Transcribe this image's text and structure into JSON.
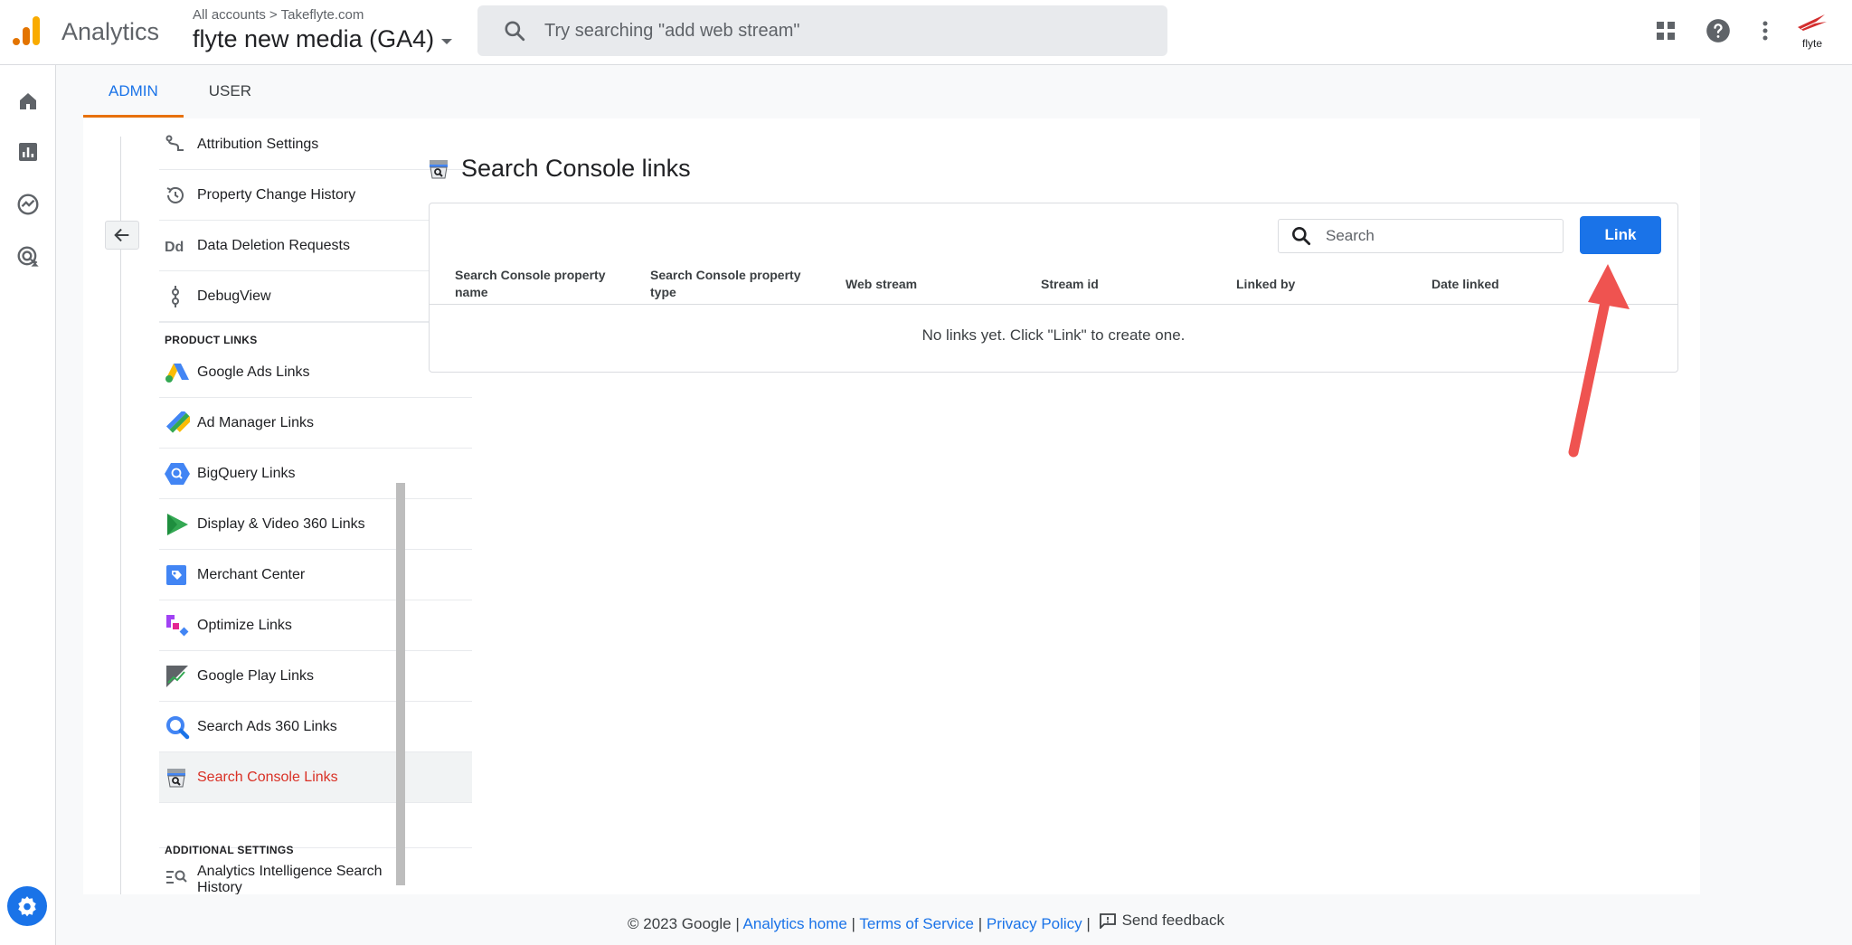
{
  "header": {
    "app_name": "Analytics",
    "breadcrumb_root": "All accounts",
    "breadcrumb_sep": ">",
    "breadcrumb_account": "Takeflyte.com",
    "property_name": "flyte new media (GA4)",
    "search_placeholder": "Try searching \"add web stream\"",
    "brand_text": "flyte"
  },
  "tabs": [
    {
      "label": "ADMIN",
      "active": true
    },
    {
      "label": "USER",
      "active": false
    }
  ],
  "sidebar": {
    "items_top": [
      {
        "label": "Attribution Settings",
        "icon": "attribution-icon"
      },
      {
        "label": "Property Change History",
        "icon": "history-icon"
      },
      {
        "label": "Data Deletion Requests",
        "icon": "data-deletion-icon"
      },
      {
        "label": "DebugView",
        "icon": "debug-icon"
      }
    ],
    "product_links_heading": "PRODUCT LINKS",
    "product_links": [
      {
        "label": "Google Ads Links",
        "icon": "google-ads-icon"
      },
      {
        "label": "Ad Manager Links",
        "icon": "ad-manager-icon"
      },
      {
        "label": "BigQuery Links",
        "icon": "bigquery-icon"
      },
      {
        "label": "Display & Video 360 Links",
        "icon": "display-video-icon"
      },
      {
        "label": "Merchant Center",
        "icon": "merchant-center-icon"
      },
      {
        "label": "Optimize Links",
        "icon": "optimize-icon"
      },
      {
        "label": "Google Play Links",
        "icon": "google-play-icon"
      },
      {
        "label": "Search Ads 360 Links",
        "icon": "search-ads-icon"
      },
      {
        "label": "Search Console Links",
        "icon": "search-console-icon",
        "active": true
      }
    ],
    "additional_heading": "ADDITIONAL SETTINGS",
    "additional_items": [
      {
        "label": "Analytics Intelligence Search History",
        "icon": "intelligence-search-icon"
      }
    ]
  },
  "main": {
    "title": "Search Console links",
    "search_placeholder": "Search",
    "link_button": "Link",
    "columns": [
      "Search Console property name",
      "Search Console property type",
      "Web stream",
      "Stream id",
      "Linked by",
      "Date linked"
    ],
    "empty_message": "No links yet. Click \"Link\" to create one."
  },
  "footer": {
    "copyright": "© 2023 Google |",
    "analytics_home": "Analytics home",
    "sep1": "|",
    "terms": "Terms of Service",
    "sep2": "|",
    "privacy": "Privacy Policy",
    "sep3": "|",
    "feedback": "Send feedback"
  },
  "colors": {
    "accent": "#1a73e8",
    "active_tab_underline": "#e8710a",
    "active_nav": "#d93025",
    "annotation_arrow": "#ef5350"
  }
}
